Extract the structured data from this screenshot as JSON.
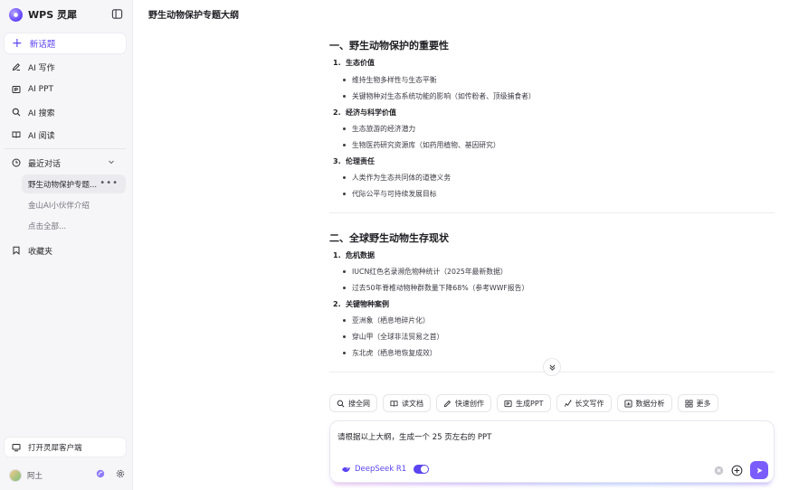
{
  "app": {
    "name": "WPS 灵犀",
    "page_title": "野生动物保护专题大纲"
  },
  "sidebar": {
    "new_topic": "新话题",
    "nav": [
      {
        "label": "AI 写作",
        "icon": "pen-icon"
      },
      {
        "label": "AI PPT",
        "icon": "ppt-icon"
      },
      {
        "label": "AI 搜索",
        "icon": "search-icon"
      },
      {
        "label": "AI 阅读",
        "icon": "book-icon"
      }
    ],
    "recent_label": "最近对话",
    "recent": [
      "野生动物保护专题...",
      "金山AI小伙伴介绍",
      "点击全部..."
    ],
    "favorites_label": "收藏夹",
    "open_client": "打开灵犀客户端",
    "user_name": "阿土"
  },
  "document": {
    "sections": [
      {
        "heading": "一、野生动物保护的重要性",
        "items": [
          {
            "num": "1.",
            "title": "生态价值",
            "bullets": [
              "维持生物多样性与生态平衡",
              "关键物种对生态系统功能的影响（如传粉者、顶级捕食者）"
            ]
          },
          {
            "num": "2.",
            "title": "经济与科学价值",
            "bullets": [
              "生态旅游的经济潜力",
              "生物医药研究资源库（如药用植物、基因研究）"
            ]
          },
          {
            "num": "3.",
            "title": "伦理责任",
            "bullets": [
              "人类作为生态共同体的道德义务",
              "代际公平与可持续发展目标"
            ]
          }
        ]
      },
      {
        "heading": "二、全球野生动物生存现状",
        "items": [
          {
            "num": "1.",
            "title": "危机数据",
            "bullets": [
              "IUCN红色名录濒危物种统计（2025年最新数据）",
              "过去50年脊椎动物种群数量下降68%（参考WWF报告）"
            ]
          },
          {
            "num": "2.",
            "title": "关键物种案例",
            "bullets": [
              "亚洲象（栖息地碎片化）",
              "穿山甲（全球非法贸易之首）",
              "东北虎（栖息地恢复成效）"
            ]
          }
        ]
      }
    ]
  },
  "chips": [
    {
      "label": "搜全网",
      "icon": "search-icon"
    },
    {
      "label": "读文档",
      "icon": "book-icon"
    },
    {
      "label": "快速创作",
      "icon": "pen-icon"
    },
    {
      "label": "生成PPT",
      "icon": "ppt-icon"
    },
    {
      "label": "长文写作",
      "icon": "longtext-icon"
    },
    {
      "label": "数据分析",
      "icon": "chart-icon"
    },
    {
      "label": "更多",
      "icon": "grid-icon"
    }
  ],
  "input": {
    "value": "请根据以上大纲，生成一个 25 页左右的 PPT",
    "model": "DeepSeek R1"
  },
  "colors": {
    "accent": "#5b45f0",
    "sidebar_bg": "#f6f6f8",
    "send_button": "#7b5cff"
  }
}
